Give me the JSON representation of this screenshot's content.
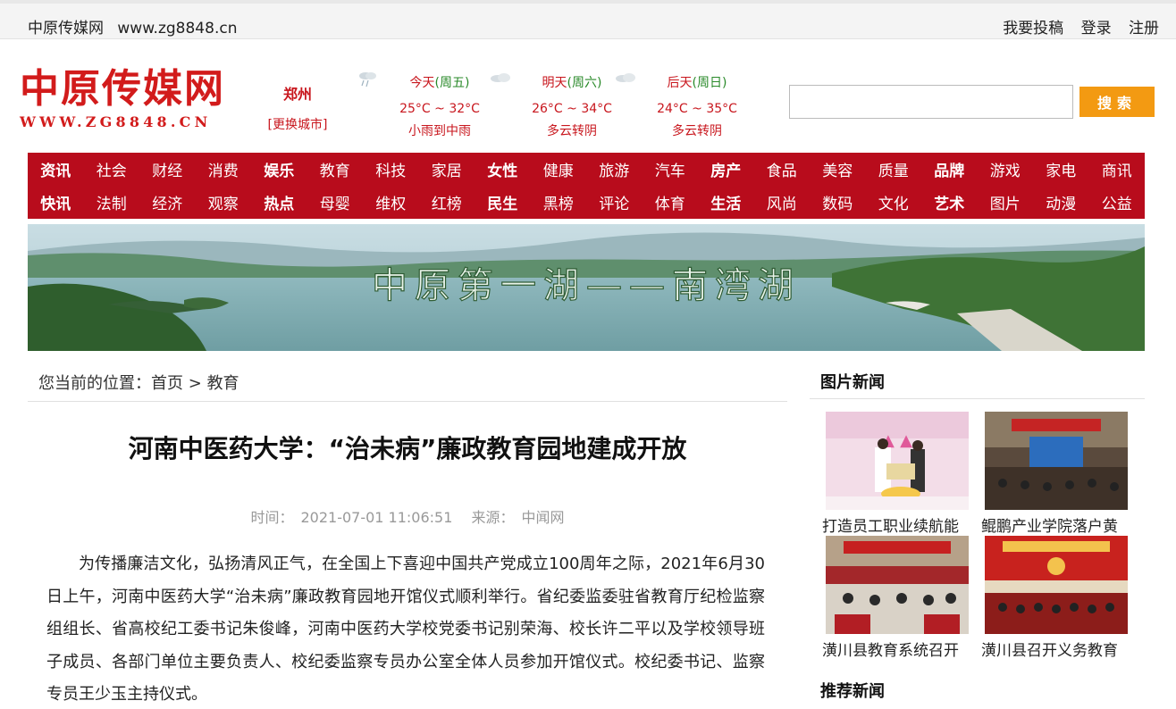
{
  "topbar": {
    "site_name": "中原传媒网",
    "site_url": "www.zg8848.cn",
    "links": [
      "我要投稿",
      "登录",
      "注册"
    ]
  },
  "logo": {
    "chinese": "中原传媒网",
    "url": "WWW.ZG8848.CN"
  },
  "city": {
    "name": "郑州",
    "change": "[更换城市]"
  },
  "weather": [
    {
      "day": "今天",
      "weekday": "(周五)",
      "temp": "25°C ~ 32°C",
      "desc": "小雨到中雨",
      "icon": "rain-cloud-icon"
    },
    {
      "day": "明天",
      "weekday": "(周六)",
      "temp": "26°C ~ 34°C",
      "desc": "多云转阴",
      "icon": "cloudy-icon"
    },
    {
      "day": "后天",
      "weekday": "(周日)",
      "temp": "24°C ~ 35°C",
      "desc": "多云转阴",
      "icon": "cloudy-icon"
    }
  ],
  "search": {
    "placeholder": "",
    "button": "搜索"
  },
  "nav": {
    "row1": [
      "资讯",
      "社会",
      "财经",
      "消费",
      "娱乐",
      "教育",
      "科技",
      "家居",
      "女性",
      "健康",
      "旅游",
      "汽车",
      "房产",
      "食品",
      "美容",
      "质量",
      "品牌",
      "游戏",
      "家电",
      "商讯"
    ],
    "row2": [
      "快讯",
      "法制",
      "经济",
      "观察",
      "热点",
      "母婴",
      "维权",
      "红榜",
      "民生",
      "黑榜",
      "评论",
      "体育",
      "生活",
      "风尚",
      "数码",
      "文化",
      "艺术",
      "图片",
      "动漫",
      "公益"
    ],
    "bold_row1": [
      "资讯",
      "娱乐",
      "女性",
      "房产",
      "品牌"
    ],
    "bold_row2": [
      "快讯",
      "热点",
      "民生",
      "生活",
      "艺术"
    ]
  },
  "banner": {
    "caption": "中原第一湖——南湾湖"
  },
  "breadcrumb": {
    "prefix": "您当前的位置：",
    "home": "首页",
    "sep": ">",
    "current": "教育"
  },
  "article": {
    "title": "河南中医药大学：“治未病”廉政教育园地建成开放",
    "time_label": "时间：",
    "time": "2021-07-01 11:06:51",
    "source_label": "来源：",
    "source": "中闻网",
    "body": "为传播廉洁文化，弘扬清风正气，在全国上下喜迎中国共产党成立100周年之际，2021年6月30日上午，河南中医药大学“治未病”廉政教育园地开馆仪式顺利举行。省纪委监委驻省教育厅纪检监察组组长、省高校纪工委书记朱俊峰，河南中医药大学校党委书记别荣海、校长许二平以及学校领导班子成员、各部门单位主要负责人、校纪委监察专员办公室全体人员参加开馆仪式。校纪委书记、监察专员王少玉主持仪式。"
  },
  "sidebar": {
    "photo_news_title": "图片新闻",
    "photos": [
      {
        "caption": "打造员工职业续航能"
      },
      {
        "caption": "鲲鹏产业学院落户黄"
      },
      {
        "caption": "潢川县教育系统召开"
      },
      {
        "caption": "潢川县召开义务教育"
      }
    ],
    "recommend_title": "推荐新闻"
  },
  "colors": {
    "brand_red": "#b80c1c",
    "search_orange": "#f39a12"
  }
}
